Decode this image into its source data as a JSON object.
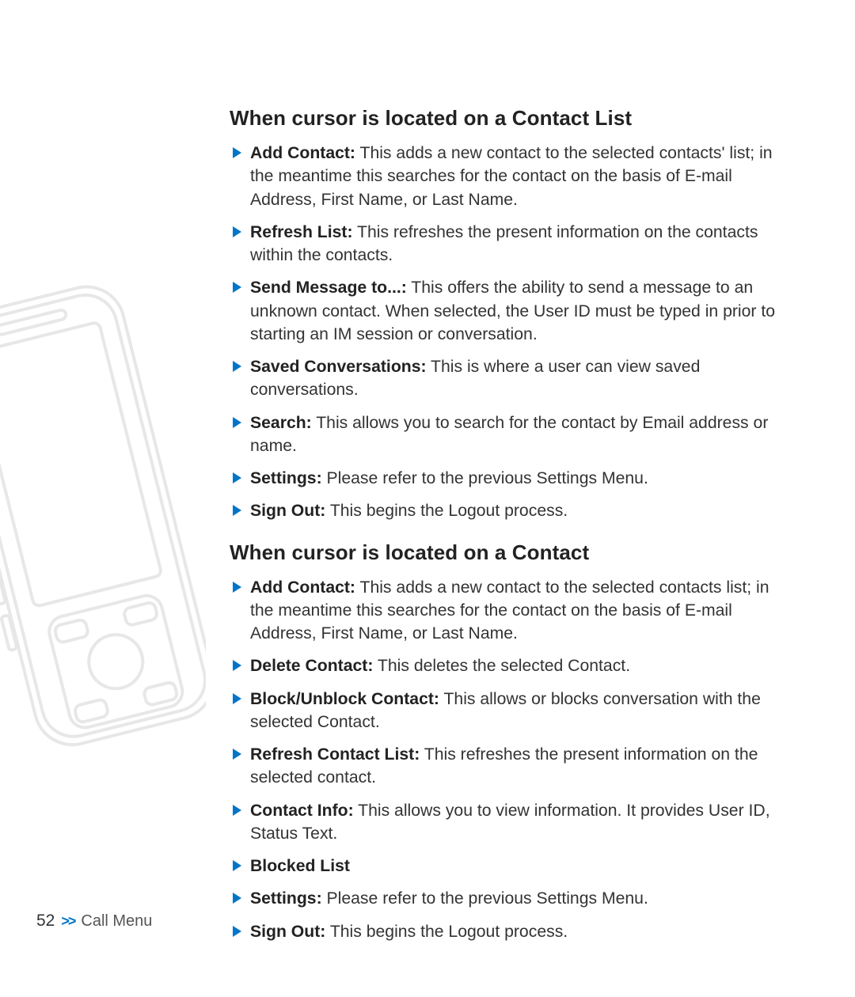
{
  "footer": {
    "page_number": "52",
    "chevrons": ">>",
    "section": "Call Menu"
  },
  "sections": [
    {
      "heading": "When cursor is located on a Contact List",
      "items": [
        {
          "label": "Add Contact:",
          "text": " This adds a new contact to the selected contacts' list; in the meantime this searches for the contact on the basis of E-mail Address, First Name, or Last Name."
        },
        {
          "label": "Refresh List:",
          "text": " This refreshes the present information on the contacts within the contacts."
        },
        {
          "label": "Send Message to...:",
          "text": " This offers the ability to send a message to an unknown contact. When selected, the User ID must be typed in prior to starting an IM session or conversation."
        },
        {
          "label": "Saved Conversations:",
          "text": " This is where a user can view saved conversations."
        },
        {
          "label": "Search:",
          "text": " This allows you to search for the contact by Email address or name."
        },
        {
          "label": "Settings:",
          "text": " Please refer to the previous Settings Menu."
        },
        {
          "label": "Sign Out:",
          "text": " This begins the Logout process."
        }
      ]
    },
    {
      "heading": "When cursor is located on a Contact",
      "items": [
        {
          "label": "Add Contact:",
          "text": " This adds a new contact to the selected contacts list; in the meantime this searches for the contact on the basis of E-mail Address, First Name, or Last Name."
        },
        {
          "label": "Delete Contact:",
          "text": " This deletes the selected Contact."
        },
        {
          "label": "Block/Unblock Contact:",
          "text": " This allows or blocks conversation with the selected Contact."
        },
        {
          "label": "Refresh Contact List:",
          "text": " This refreshes the present information on the selected contact."
        },
        {
          "label": "Contact Info:",
          "text": " This allows you to view information. It provides User ID, Status Text."
        },
        {
          "label": "Blocked List",
          "text": ""
        },
        {
          "label": "Settings:",
          "text": " Please refer to the previous Settings Menu."
        },
        {
          "label": "Sign Out:",
          "text": " This begins the Logout process."
        }
      ]
    }
  ]
}
